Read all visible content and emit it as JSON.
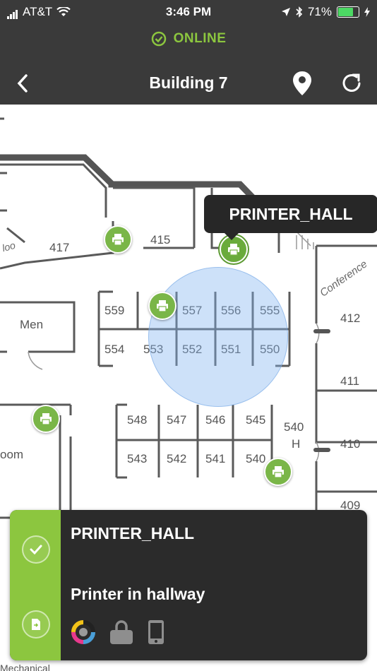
{
  "status_bar": {
    "carrier": "AT&T",
    "time": "3:46 PM",
    "battery": "71%",
    "battery_level": 0.71
  },
  "connection": {
    "status": "ONLINE",
    "color": "#8cc63f"
  },
  "nav": {
    "title": "Building 7",
    "icons": [
      "back-chevron-icon",
      "location-pin-icon",
      "refresh-icon"
    ]
  },
  "map": {
    "rooms": [
      {
        "id": "r417",
        "label": "417"
      },
      {
        "id": "r415",
        "label": "415"
      },
      {
        "id": "r559",
        "label": "559"
      },
      {
        "id": "r557",
        "label": "557"
      },
      {
        "id": "r556",
        "label": "556"
      },
      {
        "id": "r555",
        "label": "555"
      },
      {
        "id": "r554",
        "label": "554"
      },
      {
        "id": "r553",
        "label": "553"
      },
      {
        "id": "r552",
        "label": "552"
      },
      {
        "id": "r551",
        "label": "551"
      },
      {
        "id": "r550",
        "label": "550"
      },
      {
        "id": "r548",
        "label": "548"
      },
      {
        "id": "r547",
        "label": "547"
      },
      {
        "id": "r546",
        "label": "546"
      },
      {
        "id": "r545",
        "label": "545"
      },
      {
        "id": "r543",
        "label": "543"
      },
      {
        "id": "r542",
        "label": "542"
      },
      {
        "id": "r541",
        "label": "541"
      },
      {
        "id": "r540",
        "label": "540"
      },
      {
        "id": "r540h",
        "label": "540"
      },
      {
        "id": "r412",
        "label": "412"
      },
      {
        "id": "r411",
        "label": "411"
      },
      {
        "id": "r410",
        "label": "410"
      },
      {
        "id": "r409",
        "label": "409"
      }
    ],
    "labels": {
      "men": "Men",
      "conference": "Conference",
      "h": "H",
      "room_partial": "oom",
      "mechanical_partial": "Mechanical",
      "loo_partial": "loo"
    },
    "selected_printer_name": "PRINTER_HALL"
  },
  "panel": {
    "title": "PRINTER_HALL",
    "description": "Printer in hallway",
    "accent": "#8cc63f",
    "status_icons": [
      "color-printing-icon",
      "secure-lock-icon",
      "mobile-device-icon"
    ]
  }
}
